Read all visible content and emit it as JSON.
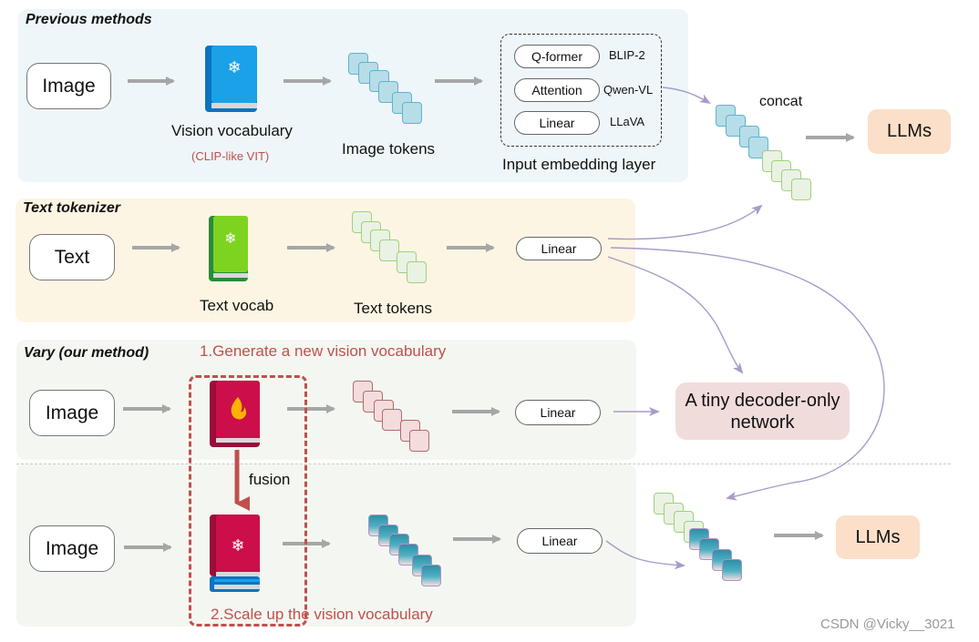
{
  "sections": {
    "previous": {
      "title": "Previous methods",
      "input_label": "Image",
      "vocab_label": "Vision vocabulary",
      "vocab_sublabel": "(CLIP-like VIT)",
      "tokens_label": "Image tokens",
      "embedding_layer_label": "Input embedding layer",
      "embedding_options": [
        {
          "module": "Q-former",
          "model": "BLIP-2"
        },
        {
          "module": "Attention",
          "model": "Qwen-VL"
        },
        {
          "module": "Linear",
          "model": "LLaVA"
        }
      ],
      "concat_label": "concat",
      "output_label": "LLMs"
    },
    "text": {
      "title": "Text tokenizer",
      "input_label": "Text",
      "vocab_label": "Text vocab",
      "tokens_label": "Text tokens",
      "layer_label": "Linear"
    },
    "vary": {
      "title": "Vary (our method)",
      "step1_label": "1.Generate a new vision vocabulary",
      "step2_label": "2.Scale up the vision vocabulary",
      "input1_label": "Image",
      "input2_label": "Image",
      "layer1_label": "Linear",
      "layer2_label": "Linear",
      "fusion_label": "fusion",
      "decoder_label": "A tiny decoder-only network",
      "output_label": "LLMs"
    }
  },
  "icons": {
    "vision_vocab": "frozen-book-icon",
    "text_vocab": "frozen-book-icon",
    "new_vocab": "trainable-book-icon",
    "scaled_vocab": "frozen-stacked-book-icon"
  },
  "colors": {
    "accent_red": "#c0504d",
    "arrow_gray": "#a6a6a6",
    "connector_purple": "#a99bc9",
    "llm_fill": "#fbdfc8",
    "decoder_fill": "#f1dcdc"
  },
  "watermark": "CSDN @Vicky__3021"
}
